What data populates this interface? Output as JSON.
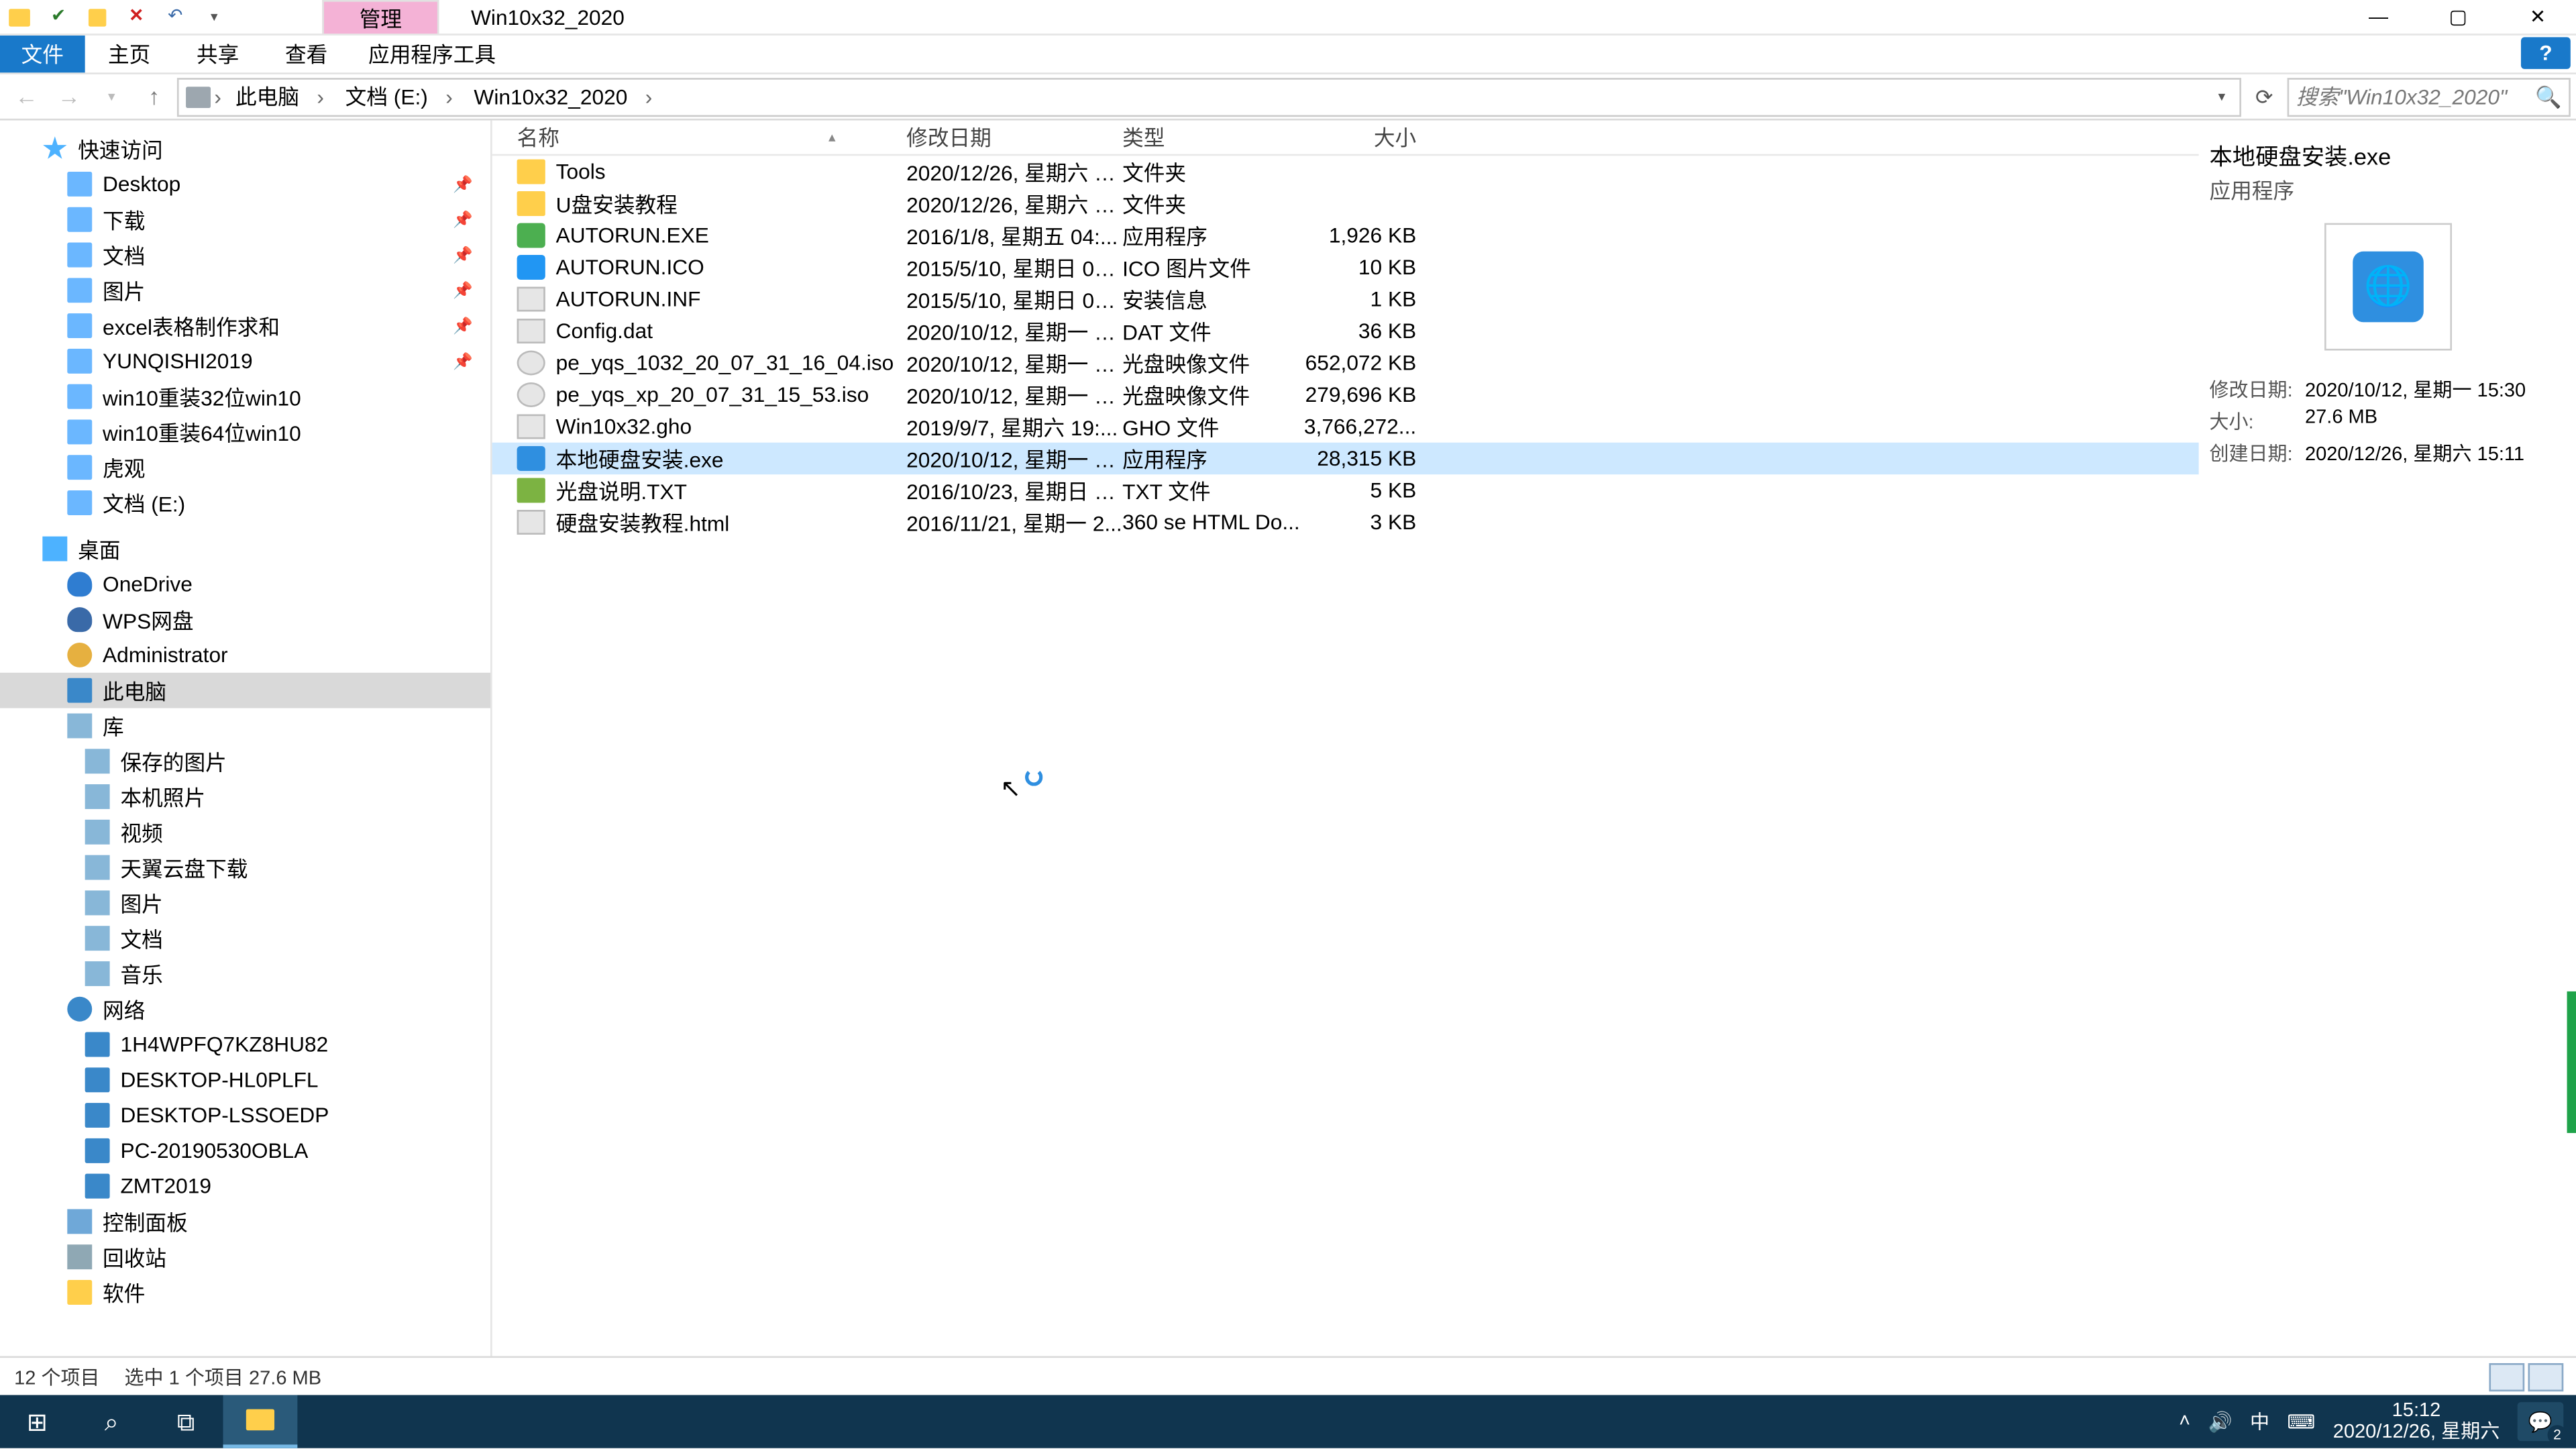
{
  "titlebar": {
    "manage": "管理",
    "title": "Win10x32_2020"
  },
  "ribbon": {
    "file": "文件",
    "tabs": [
      "主页",
      "共享",
      "查看"
    ],
    "tool": "应用程序工具"
  },
  "addr": {
    "crumbs": [
      "此电脑",
      "文档 (E:)",
      "Win10x32_2020"
    ],
    "search_ph": "搜索\"Win10x32_2020\""
  },
  "nav": {
    "quick": "快速访问",
    "quick_items": [
      {
        "label": "Desktop",
        "pin": true
      },
      {
        "label": "下载",
        "pin": true
      },
      {
        "label": "文档",
        "pin": true
      },
      {
        "label": "图片",
        "pin": true
      },
      {
        "label": "excel表格制作求和",
        "pin": true
      },
      {
        "label": "YUNQISHI2019",
        "pin": true
      },
      {
        "label": "win10重装32位win10"
      },
      {
        "label": "win10重装64位win10"
      },
      {
        "label": "虎观"
      },
      {
        "label": "文档 (E:)"
      }
    ],
    "desktop": "桌面",
    "desk_items": [
      "OneDrive",
      "WPS网盘",
      "Administrator",
      "此电脑",
      "库"
    ],
    "lib_items": [
      "保存的图片",
      "本机照片",
      "视频",
      "天翼云盘下载",
      "图片",
      "文档",
      "音乐"
    ],
    "network": "网络",
    "net_items": [
      "1H4WPFQ7KZ8HU82",
      "DESKTOP-HL0PLFL",
      "DESKTOP-LSSOEDP",
      "PC-20190530OBLA",
      "ZMT2019"
    ],
    "cp": "控制面板",
    "recycle": "回收站",
    "soft": "软件"
  },
  "cols": {
    "name": "名称",
    "date": "修改日期",
    "type": "类型",
    "size": "大小"
  },
  "files": [
    {
      "ic": "folder",
      "name": "Tools",
      "date": "2020/12/26, 星期六 1...",
      "type": "文件夹",
      "size": ""
    },
    {
      "ic": "folder",
      "name": "U盘安装教程",
      "date": "2020/12/26, 星期六 1...",
      "type": "文件夹",
      "size": ""
    },
    {
      "ic": "exe",
      "name": "AUTORUN.EXE",
      "date": "2016/1/8, 星期五 04:...",
      "type": "应用程序",
      "size": "1,926 KB"
    },
    {
      "ic": "ico",
      "name": "AUTORUN.ICO",
      "date": "2015/5/10, 星期日 02...",
      "type": "ICO 图片文件",
      "size": "10 KB"
    },
    {
      "ic": "inf",
      "name": "AUTORUN.INF",
      "date": "2015/5/10, 星期日 02...",
      "type": "安装信息",
      "size": "1 KB"
    },
    {
      "ic": "dat",
      "name": "Config.dat",
      "date": "2020/10/12, 星期一 1...",
      "type": "DAT 文件",
      "size": "36 KB"
    },
    {
      "ic": "iso",
      "name": "pe_yqs_1032_20_07_31_16_04.iso",
      "date": "2020/10/12, 星期一 1...",
      "type": "光盘映像文件",
      "size": "652,072 KB"
    },
    {
      "ic": "iso",
      "name": "pe_yqs_xp_20_07_31_15_53.iso",
      "date": "2020/10/12, 星期一 1...",
      "type": "光盘映像文件",
      "size": "279,696 KB"
    },
    {
      "ic": "gho",
      "name": "Win10x32.gho",
      "date": "2019/9/7, 星期六 19:...",
      "type": "GHO 文件",
      "size": "3,766,272..."
    },
    {
      "ic": "app",
      "name": "本地硬盘安装.exe",
      "date": "2020/10/12, 星期一 1...",
      "type": "应用程序",
      "size": "28,315 KB",
      "sel": true
    },
    {
      "ic": "txt",
      "name": "光盘说明.TXT",
      "date": "2016/10/23, 星期日 0...",
      "type": "TXT 文件",
      "size": "5 KB"
    },
    {
      "ic": "html",
      "name": "硬盘安装教程.html",
      "date": "2016/11/21, 星期一 2...",
      "type": "360 se HTML Do...",
      "size": "3 KB"
    }
  ],
  "preview": {
    "name": "本地硬盘安装.exe",
    "type": "应用程序",
    "meta": [
      [
        "修改日期:",
        "2020/10/12, 星期一 15:30"
      ],
      [
        "大小:",
        "27.6 MB"
      ],
      [
        "创建日期:",
        "2020/12/26, 星期六 15:11"
      ]
    ]
  },
  "status": {
    "count": "12 个项目",
    "sel": "选中 1 个项目  27.6 MB"
  },
  "tray": {
    "ime": "中",
    "time": "15:12",
    "date": "2020/12/26, 星期六",
    "badge": "2"
  }
}
